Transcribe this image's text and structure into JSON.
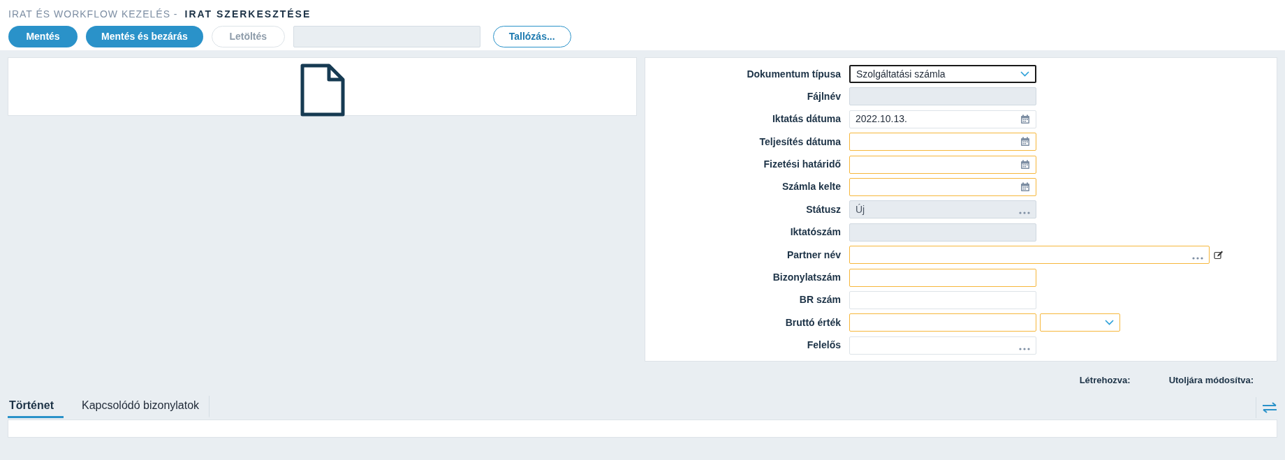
{
  "header": {
    "section": "IRAT ÉS WORKFLOW KEZELÉS -",
    "title": "IRAT SZERKESZTÉSE"
  },
  "toolbar": {
    "buttons": [
      {
        "label": "Mentés",
        "disabled": false
      },
      {
        "label": "Mentés és bezárás",
        "disabled": false
      },
      {
        "label": "Letöltés",
        "disabled": true
      }
    ],
    "file_field": {
      "readonly": true
    },
    "browse": "Tallózás..."
  },
  "form": {
    "fields": [
      {
        "label": "Dokumentum típusa",
        "kind": "select",
        "value": "Szolgáltatási számla",
        "required": false,
        "readonly": false,
        "focused": true
      },
      {
        "label": "Fájlnév",
        "kind": "text",
        "required": false,
        "readonly": true,
        "focused": false
      },
      {
        "label": "Iktatás dátuma",
        "kind": "date",
        "value": "2022.10.13.",
        "required": false,
        "readonly": false,
        "focused": false
      },
      {
        "label": "Teljesítés dátuma",
        "kind": "date",
        "required": true,
        "readonly": false,
        "focused": false
      },
      {
        "label": "Fizetési határidő",
        "kind": "date",
        "required": true,
        "readonly": false,
        "focused": false
      },
      {
        "label": "Számla kelte",
        "kind": "date",
        "required": true,
        "readonly": false,
        "focused": false
      },
      {
        "label": "Státusz",
        "kind": "lookup",
        "value": "Új",
        "required": false,
        "readonly": true,
        "focused": false
      },
      {
        "label": "Iktatószám",
        "kind": "text",
        "required": false,
        "readonly": true,
        "focused": false
      },
      {
        "label": "Partner név",
        "kind": "lookup_edit",
        "required": true,
        "readonly": false,
        "focused": false
      },
      {
        "label": "Bizonylatszám",
        "kind": "text",
        "required": true,
        "readonly": false,
        "focused": false
      },
      {
        "label": "BR szám",
        "kind": "text",
        "required": false,
        "readonly": false,
        "focused": false
      },
      {
        "label": "Bruttó érték",
        "kind": "amount",
        "required": true,
        "readonly": false,
        "focused": false
      },
      {
        "label": "Felelős",
        "kind": "lookup",
        "required": false,
        "readonly": false,
        "focused": false
      }
    ]
  },
  "meta": [
    "Létrehozva:",
    "Utoljára módosítva:"
  ],
  "tabs": [
    {
      "label": "Történet",
      "selected": true
    },
    {
      "label": "Kapcsolódó bizonylatok",
      "selected": false
    }
  ]
}
